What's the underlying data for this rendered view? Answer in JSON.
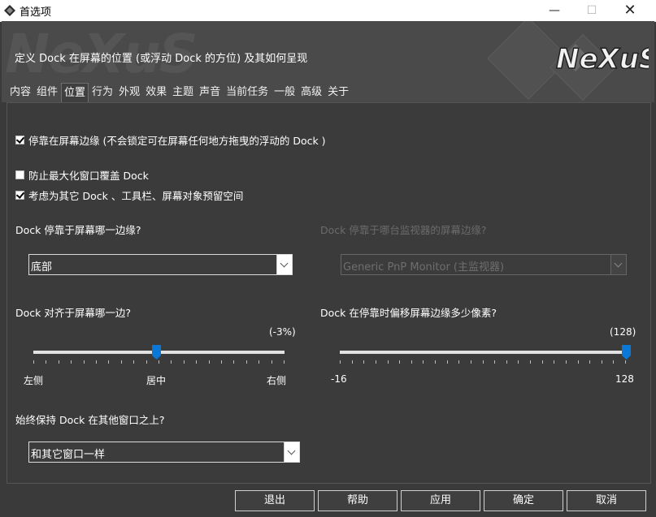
{
  "window": {
    "title": "首选项",
    "minimize": "—",
    "maximize": "☐",
    "close": "✕"
  },
  "header": {
    "background_logo": "NeXuS",
    "description": "定义 Dock 在屏幕的位置 (或浮动 Dock 的方位) 及其如何呈现",
    "logo_text": "NeXuS"
  },
  "tabs": [
    "内容",
    "组件",
    "位置",
    "行为",
    "外观",
    "效果",
    "主题",
    "声音",
    "当前任务",
    "一般",
    "高级",
    "关于"
  ],
  "active_tab": "位置",
  "options": {
    "dock_at_edge": {
      "label": "停靠在屏幕边缘 (不会锁定可在屏幕任何地方拖曳的浮动的 Dock )",
      "checked": true
    },
    "prevent_maximize": {
      "label": "防止最大化窗口覆盖 Dock",
      "checked": false
    },
    "reserve_space": {
      "label": "考虑为其它 Dock 、工具栏、屏幕对象预留空间",
      "checked": true
    }
  },
  "edge": {
    "question": "Dock 停靠于屏幕哪一边缘?",
    "value": "底部"
  },
  "monitor": {
    "question": "Dock 停靠于哪台监视器的屏幕边缘?",
    "value": "Generic PnP Monitor (主监视器)",
    "disabled": true
  },
  "align": {
    "question": "Dock 对齐于屏幕哪一边?",
    "value_text": "(-3%)",
    "fraction": 0.49,
    "left_label": "左侧",
    "center_label": "居中",
    "right_label": "右侧"
  },
  "offset": {
    "question": "Dock 在停靠时偏移屏幕边缘多少像素?",
    "value_text": "(128)",
    "min_label": "-16",
    "max_label": "128",
    "value": 128
  },
  "ontop": {
    "question": "始终保持 Dock 在其他窗口之上?",
    "value": "和其它窗口一样"
  },
  "buttons": {
    "exit": "退出",
    "help": "帮助",
    "apply": "应用",
    "ok": "确定",
    "cancel": "取消"
  },
  "colors": {
    "accent": "#0a78d7",
    "background": "#3b3b3b"
  }
}
